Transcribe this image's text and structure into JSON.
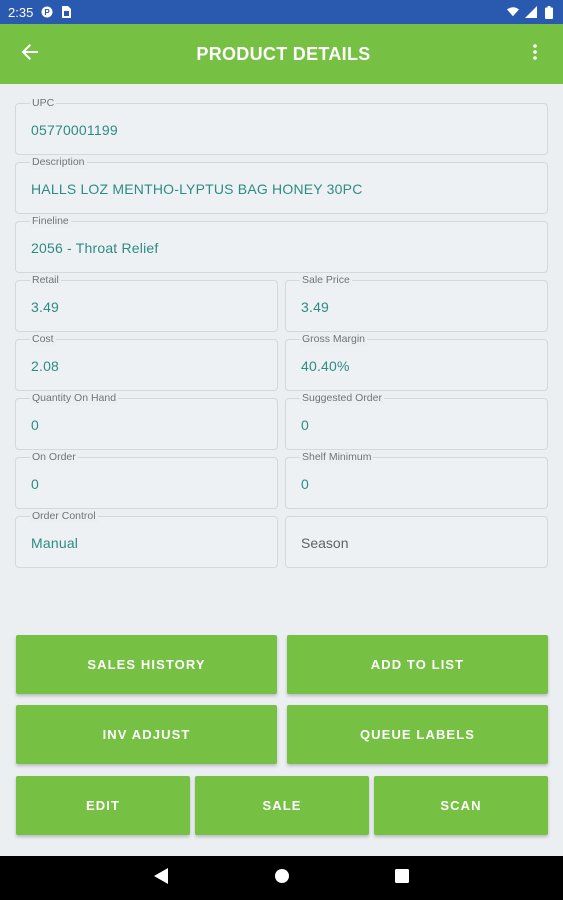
{
  "status_bar": {
    "time": "2:35",
    "icons": [
      "p-notification-icon",
      "sim-card-icon",
      "wifi-icon",
      "signal-icon",
      "battery-icon"
    ]
  },
  "app_bar": {
    "title": "PRODUCT DETAILS",
    "back_icon": "arrow-back-icon",
    "menu_icon": "more-vert-icon",
    "color": "#76c043"
  },
  "fields": {
    "upc": {
      "label": "UPC",
      "value": "05770001199"
    },
    "description": {
      "label": "Description",
      "value": "HALLS LOZ MENTHO-LYPTUS BAG HONEY 30PC"
    },
    "fineline": {
      "label": "Fineline",
      "value": "2056 - Throat Relief"
    },
    "retail": {
      "label": "Retail",
      "value": "3.49"
    },
    "sale_price": {
      "label": "Sale Price",
      "value": "3.49"
    },
    "cost": {
      "label": "Cost",
      "value": "2.08"
    },
    "gross_margin": {
      "label": "Gross Margin",
      "value": "40.40%"
    },
    "quantity_on_hand": {
      "label": "Quantity On Hand",
      "value": "0"
    },
    "suggested_order": {
      "label": "Suggested Order",
      "value": "0"
    },
    "on_order": {
      "label": "On Order",
      "value": "0"
    },
    "shelf_minimum": {
      "label": "Shelf Minimum",
      "value": "0"
    },
    "order_control": {
      "label": "Order Control",
      "value": "Manual"
    },
    "season": {
      "placeholder": "Season"
    }
  },
  "buttons": {
    "sales_history": "SALES HISTORY",
    "add_to_list": "ADD TO LIST",
    "inv_adjust": "INV ADJUST",
    "queue_labels": "QUEUE LABELS",
    "edit": "EDIT",
    "sale": "SALE",
    "scan": "SCAN"
  },
  "colors": {
    "accent_green": "#76c043",
    "value_teal": "#2e8b84",
    "status_bar_blue": "#2a59b0"
  },
  "nav_bar": {
    "icons": [
      "back-triangle-icon",
      "home-circle-icon",
      "recents-square-icon"
    ]
  }
}
